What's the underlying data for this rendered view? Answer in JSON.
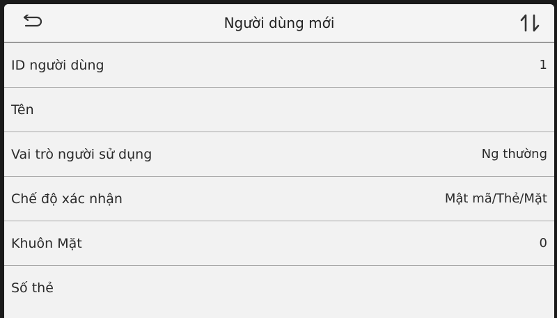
{
  "header": {
    "title": "Người dùng mới",
    "back_icon": "back-arrow-icon",
    "sort_icon": "sort-icon"
  },
  "rows": [
    {
      "label": "ID người dùng",
      "value": "1"
    },
    {
      "label": "Tên",
      "value": ""
    },
    {
      "label": "Vai trò người sử dụng",
      "value": "Ng thường"
    },
    {
      "label": "Chế độ xác nhận",
      "value": "Mật mã/Thẻ/Mặt"
    },
    {
      "label": "Khuôn Mặt",
      "value": "0"
    },
    {
      "label": "Số thẻ",
      "value": ""
    }
  ]
}
